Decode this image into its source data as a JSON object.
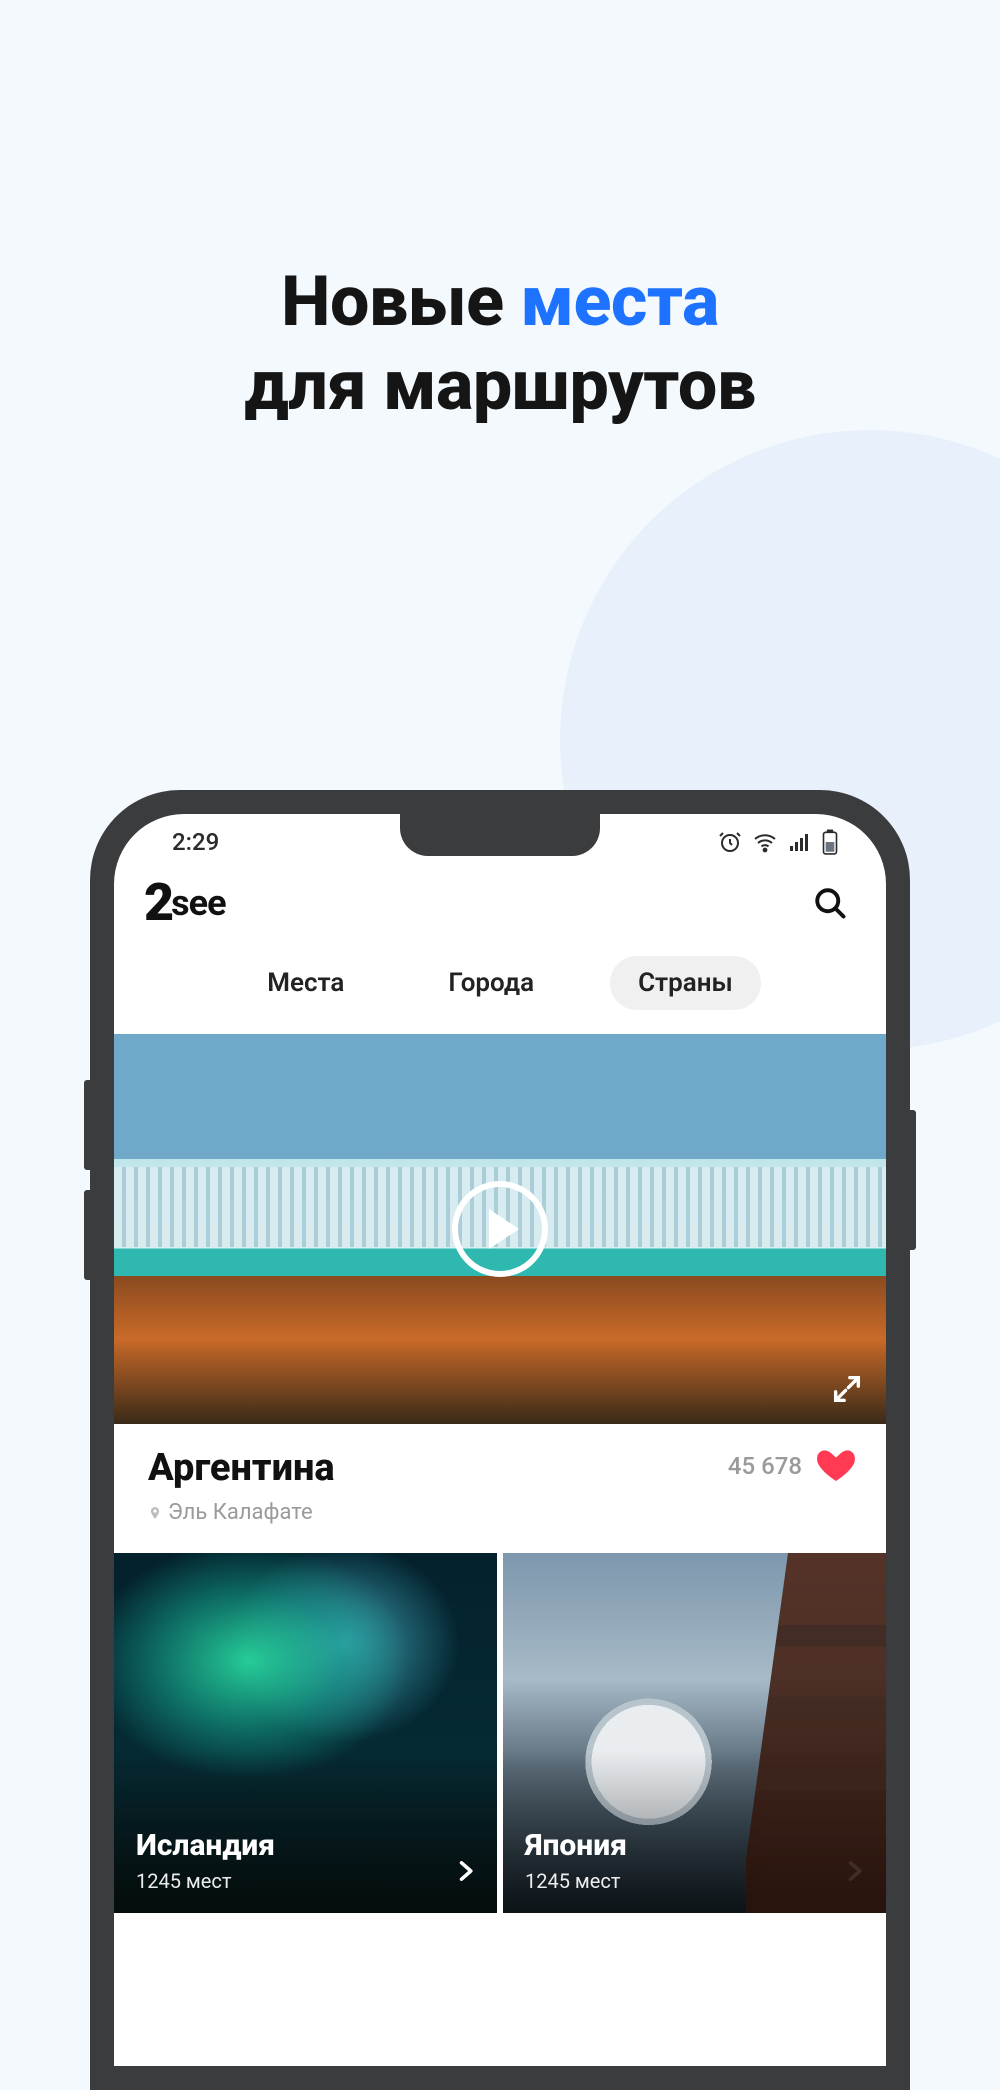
{
  "headline": {
    "pre": "Новые ",
    "accent": "места",
    "post": "для маршрутов"
  },
  "statusbar": {
    "time": "2:29"
  },
  "app": {
    "logo_prefix": "2",
    "logo_text": "see"
  },
  "tabs": {
    "items": [
      {
        "label": "Места",
        "active": false
      },
      {
        "label": "Города",
        "active": false
      },
      {
        "label": "Страны",
        "active": true
      }
    ]
  },
  "hero": {
    "title": "Аргентина",
    "location": "Эль Калафате",
    "likes": "45 678"
  },
  "grid": {
    "items": [
      {
        "title": "Исландия",
        "sub": "1245 мест"
      },
      {
        "title": "Япония",
        "sub": "1245 мест"
      }
    ]
  }
}
